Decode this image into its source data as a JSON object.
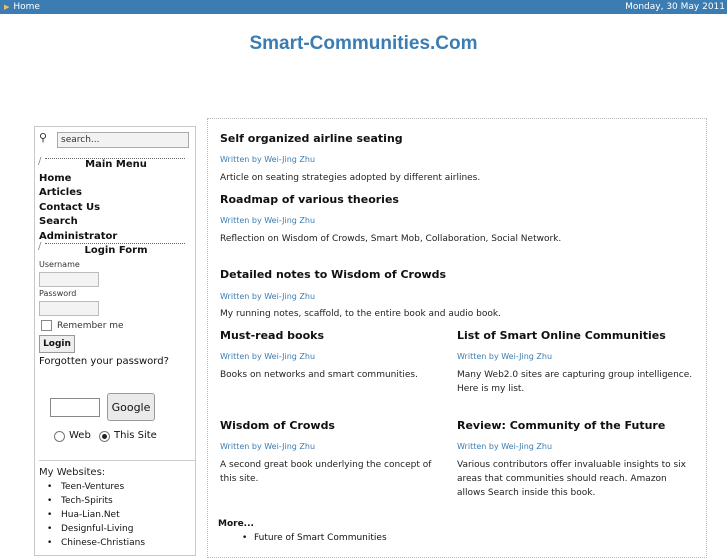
{
  "topbar": {
    "home_label": "Home",
    "date": "Monday, 30 May 2011"
  },
  "site": {
    "title": "Smart-Communities.Com"
  },
  "sidebar": {
    "search_placeholder": "search...",
    "main_menu_title": "Main Menu",
    "menu": [
      "Home",
      "Articles",
      "Contact Us",
      "Search",
      "Administrator"
    ],
    "login_form_title": "Login Form",
    "username_label": "Username",
    "password_label": "Password",
    "remember_label": "Remember me",
    "login_button": "Login",
    "forgot_password": "Forgotten your password?",
    "google_button": "Google",
    "radio_web": "Web",
    "radio_site": "This Site",
    "my_websites_title": "My Websites:",
    "websites": [
      "Teen-Ventures",
      "Tech-Spirits",
      "Hua-Lian.Net",
      "Designful-Living",
      "Chinese-Christians"
    ]
  },
  "articles": [
    {
      "title": "Self organized airline seating",
      "author": "Written by Wei-Jing Zhu",
      "text": "Article on seating strategies adopted by different airlines."
    },
    {
      "title": "Roadmap of various theories",
      "author": "Written by Wei-Jing Zhu",
      "text": "Reflection on Wisdom of Crowds, Smart Mob, Collaboration, Social Network."
    },
    {
      "title": "Detailed notes to Wisdom of Crowds",
      "author": "Written by Wei-Jing Zhu",
      "text": "My running notes, scaffold, to the entire book and audio book."
    },
    {
      "title": "Must-read books",
      "author": "Written by Wei-Jing Zhu",
      "text": "Books on networks and smart communities."
    },
    {
      "title": "List of Smart Online Communities",
      "author": "Written by Wei-Jing Zhu",
      "text": "Many Web2.0 sites are capturing group intelligence. Here is my list."
    },
    {
      "title": "Wisdom of Crowds",
      "author": "Written by Wei-Jing Zhu",
      "text": "A second great book underlying the concept of this site."
    },
    {
      "title": "Review: Community of the Future",
      "author": "Written by Wei-Jing Zhu",
      "text": "Various contributors offer invaluable insights to six areas that communities should reach.  Amazon allows Search inside this book."
    }
  ],
  "more": {
    "label": "More...",
    "items": [
      "Future of Smart Communities"
    ]
  },
  "colors": {
    "accent": "#3b7db3",
    "bar_bg": "#3b7db3"
  }
}
